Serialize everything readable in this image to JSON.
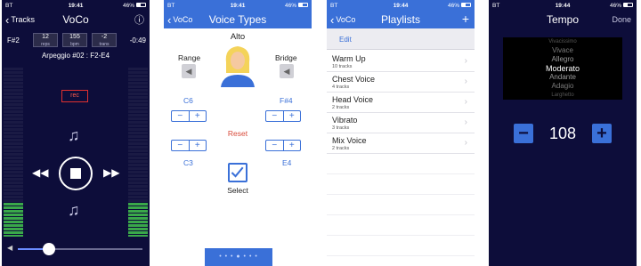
{
  "colors": {
    "accent": "#3a70d8",
    "dark_bg": "#0d0d3a",
    "rec_red": "#e03030"
  },
  "status": {
    "carrier": "BT",
    "battery": "46%"
  },
  "screen1": {
    "time": "19:41",
    "back_label": "Tracks",
    "title": "VoCo",
    "info_icon": "ⓘ",
    "note": "F#2",
    "reps_value": "12",
    "reps_label": "reps",
    "bpm_value": "155",
    "bpm_label": "bpm",
    "trans_value": "-2",
    "trans_label": "trans",
    "remaining": "-0:49",
    "exercise": "Arpeggio #02 : F2-E4",
    "rec_label": "rec",
    "volume_level": 0.25,
    "icons": [
      "back-chevron-icon",
      "info-icon",
      "music-notes-icon",
      "rewind-icon",
      "stop-icon",
      "fast-forward-icon",
      "speaker-icon"
    ]
  },
  "screen2": {
    "time": "19:41",
    "back_label": "VoCo",
    "title": "Voice Types",
    "voice_type": "Alto",
    "range_label": "Range",
    "bridge_label": "Bridge",
    "range_high": "C6",
    "range_low": "C3",
    "bridge_high": "F#4",
    "bridge_low": "E4",
    "reset_label": "Reset",
    "select_label": "Select",
    "page_indicator": "• • • ● • • •"
  },
  "screen3": {
    "time": "19:44",
    "back_label": "VoCo",
    "title": "Playlists",
    "add_label": "+",
    "edit_label": "Edit",
    "playlists": [
      {
        "name": "Warm Up",
        "count": "10 tracks"
      },
      {
        "name": "Chest Voice",
        "count": "4 tracks"
      },
      {
        "name": "Head Voice",
        "count": "2 tracks"
      },
      {
        "name": "Vibrato",
        "count": "3 tracks"
      },
      {
        "name": "Mix Voice",
        "count": "2 tracks"
      }
    ]
  },
  "screen4": {
    "time": "19:44",
    "title": "Tempo",
    "done_label": "Done",
    "picker_items": [
      "Vivacissimo",
      "Vivace",
      "Allegro",
      "Moderato",
      "Andante",
      "Adagio",
      "Larghetto"
    ],
    "picker_selected": "Moderato",
    "tempo_value": "108",
    "minus_label": "−",
    "plus_label": "+"
  }
}
